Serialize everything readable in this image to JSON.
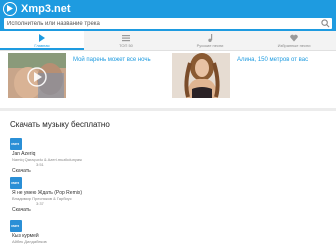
{
  "header": {
    "logo_text": "Xmp3.net",
    "search_placeholder": "Исполнитель или название трека"
  },
  "tabs": [
    {
      "label": "Главная",
      "icon": "play-icon",
      "active": true
    },
    {
      "label": "ТОП 50",
      "icon": "list-icon",
      "active": false
    },
    {
      "label": "Русские песни",
      "icon": "music-note-icon",
      "active": false
    },
    {
      "label": "Избранные песни",
      "icon": "heart-icon",
      "active": false
    }
  ],
  "promos": [
    {
      "title": "Мой парень может все ночь"
    },
    {
      "title": "Алина, 150 метров от вас"
    }
  ],
  "section": {
    "title": "Скачать музыку бесплатно"
  },
  "tracks": [
    {
      "thumb": "XMP3",
      "title": "Jan Azeriq",
      "artist": "Namiq Qaraçuxlu & Azeri.muzikdunyası",
      "duration": "3:51",
      "download": "Скачать"
    },
    {
      "thumb": "XMP3",
      "title": "Я не умею Ждать (Pop Remix)",
      "artist": "Владимир Пресняков & Гарбиус",
      "duration": "3:37",
      "download": "Скачать"
    },
    {
      "thumb": "XMP3",
      "title": "Кыз курмей",
      "artist": "Айбек Дилдабеков",
      "duration": "",
      "download": ""
    }
  ],
  "colors": {
    "accent": "#1e9be0",
    "thumb": "#2a8fd6"
  }
}
